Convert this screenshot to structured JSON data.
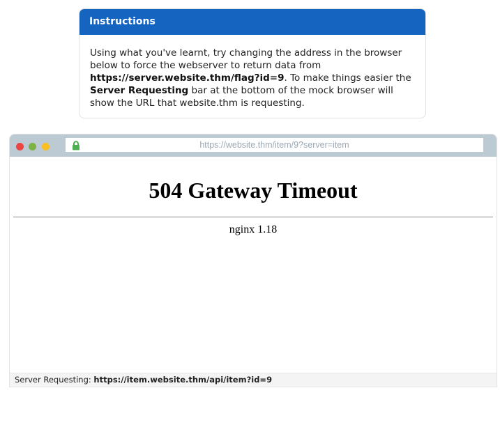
{
  "instructions": {
    "title": "Instructions",
    "text_1": "Using what you've learnt, try changing the address in the browser below to force the webserver to return data from ",
    "flag_url": "https://server.website.thm/flag?id=9",
    "text_2": ". To make things easier the ",
    "server_requesting_label": "Server Requesting",
    "text_3": " bar at the bottom of the mock browser will show the URL that website.thm is requesting."
  },
  "browser": {
    "address": "https://website.thm/item/9?server=item",
    "lock_icon": "lock-icon",
    "page": {
      "heading": "504 Gateway Timeout",
      "server_signature": "nginx 1.18"
    },
    "status_bar": {
      "label": "Server Requesting: ",
      "url": "https://item.website.thm/api/item?id=9"
    }
  },
  "colors": {
    "header_blue": "#1565c0",
    "titlebar": "#bccad4",
    "lock_green": "#4caf50",
    "dot_red": "#ef4444",
    "dot_green": "#7cb342",
    "dot_yellow": "#fbbf24"
  }
}
